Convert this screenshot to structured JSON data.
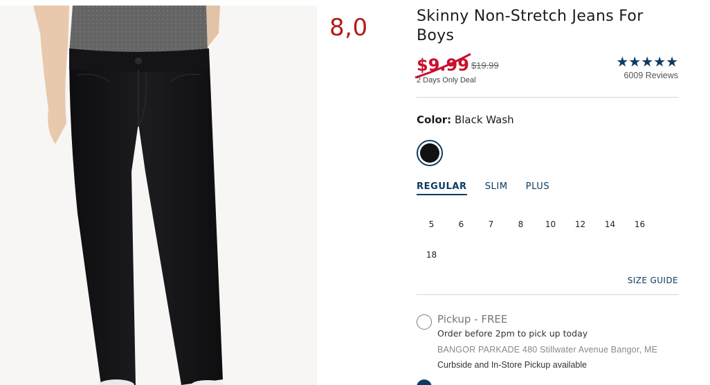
{
  "overlay_number": "8,0",
  "product": {
    "title": "Skinny Non-Stretch Jeans For Boys",
    "sale_price": "$9.99",
    "original_price": "$19.99",
    "deal_text": "2 Days Only Deal",
    "rating": {
      "stars": [
        "★",
        "★",
        "★",
        "★",
        "★"
      ],
      "review_count": "6009 Reviews"
    }
  },
  "color": {
    "label": "Color:",
    "value": "Black Wash",
    "swatch_color": "#121212"
  },
  "fit_tabs": [
    "REGULAR",
    "SLIM",
    "PLUS"
  ],
  "active_fit": "REGULAR",
  "sizes": [
    "5",
    "6",
    "7",
    "8",
    "10",
    "12",
    "14",
    "16",
    "18"
  ],
  "size_guide_label": "SIZE GUIDE",
  "pickup": {
    "title": "Pickup - FREE",
    "line1": "Order before 2pm to pick up today",
    "store": "BANGOR PARKADE 480 Stillwater Avenue  Bangor, ME",
    "note": "Curbside and In-Store Pickup available"
  },
  "colors": {
    "accent": "#0b3b62",
    "sale": "#c8102e",
    "overlay": "#b31b1b"
  }
}
